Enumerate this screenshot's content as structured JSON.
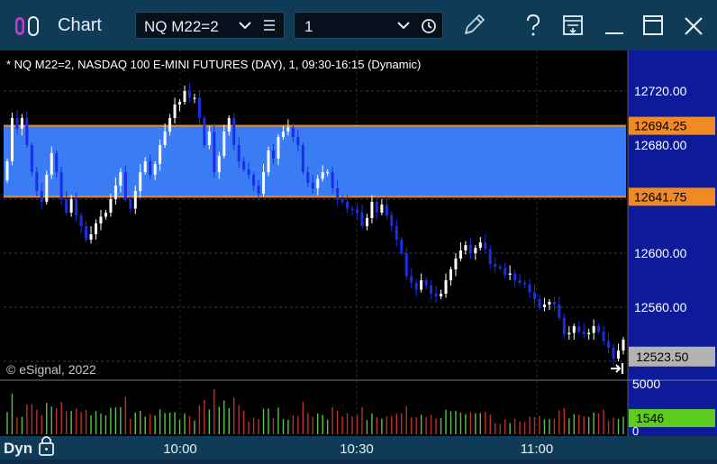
{
  "window": {
    "title": "Chart",
    "symbol": "NQ M22=2",
    "interval": "1"
  },
  "colors": {
    "titlebar": "#0f3b57",
    "band_fill": "#3a7cf4",
    "band_border": "#f08a24",
    "price_axis_bg": "#0d1a99",
    "up_candle": "#ffffff",
    "down_candle": "#1a2ee8",
    "vol_up": "#59c34a",
    "vol_down": "#c0302a",
    "last_price_bg": "#b3b3b3",
    "volume_badge_bg": "#5ccd1f"
  },
  "icons": [
    "app-logo-icon",
    "chevron-down-icon",
    "list-icon",
    "clock-icon",
    "pencil-icon",
    "help-icon",
    "template-icon",
    "minimize-icon",
    "maximize-icon",
    "close-icon",
    "lock-icon",
    "scroll-to-end-icon"
  ],
  "header_text": "* NQ M22=2, NASDAQ 100 E-MINI FUTURES (DAY), 1, 09:30-16:15 (Dynamic)",
  "copyright": "© eSignal, 2022",
  "footer": {
    "mode": "Dyn"
  },
  "chart_data": {
    "type": "candlestick",
    "title": "* NQ M22=2, NASDAQ 100 E-MINI FUTURES (DAY), 1, 09:30-16:15 (Dynamic)",
    "x_tick_labels": [
      "10:00",
      "10:30",
      "11:00"
    ],
    "y_tick_labels": [
      "12720.00",
      "12680.00",
      "12600.00",
      "12560.00"
    ],
    "ylim": [
      12506,
      12750
    ],
    "grid": true,
    "band": {
      "upper": 12694.25,
      "lower": 12641.75,
      "upper_label": "12694.25",
      "lower_label": "12641.75"
    },
    "last_price": 12523.5,
    "last_price_label": "12523.50",
    "close": [
      12668,
      12700,
      12692,
      12700,
      12680,
      12660,
      12646,
      12638,
      12658,
      12674,
      12660,
      12640,
      12630,
      12640,
      12628,
      12620,
      12610,
      12614,
      12622,
      12627,
      12630,
      12640,
      12650,
      12660,
      12640,
      12633,
      12646,
      12660,
      12668,
      12658,
      12666,
      12680,
      12690,
      12700,
      12710,
      12712,
      12720,
      12715,
      12715,
      12700,
      12680,
      12690,
      12660,
      12672,
      12690,
      12700,
      12680,
      12668,
      12662,
      12658,
      12650,
      12644,
      12660,
      12676,
      12670,
      12686,
      12690,
      12693,
      12686,
      12680,
      12660,
      12652,
      12648,
      12655,
      12660,
      12660,
      12648,
      12640,
      12638,
      12633,
      12632,
      12630,
      12620,
      12626,
      12638,
      12630,
      12636,
      12628,
      12620,
      12610,
      12600,
      12583,
      12578,
      12573,
      12580,
      12576,
      12570,
      12568,
      12570,
      12580,
      12588,
      12596,
      12602,
      12606,
      12600,
      12604,
      12608,
      12603,
      12592,
      12590,
      12589,
      12584,
      12585,
      12580,
      12578,
      12577,
      12571,
      12566,
      12560,
      12562,
      12564,
      12562,
      12552,
      12540,
      12541,
      12546,
      12542,
      12540,
      12541,
      12546,
      12542,
      12535,
      12530,
      12522,
      12528,
      12536
    ],
    "volume": {
      "ymax": 5000,
      "max_label": "5000",
      "min_label": "0",
      "current": 1546,
      "current_label": "1546"
    }
  }
}
